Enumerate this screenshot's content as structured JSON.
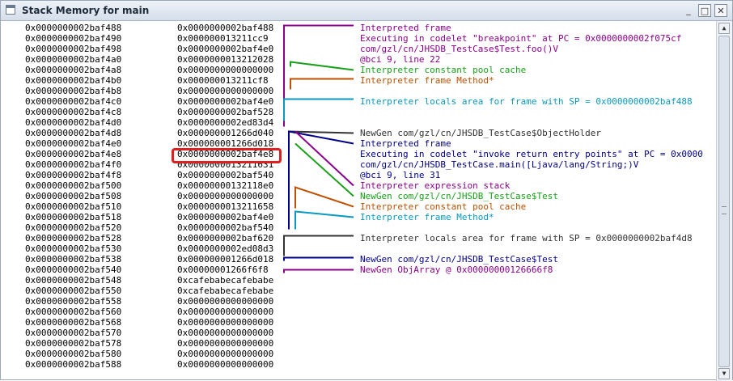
{
  "window": {
    "title": "Stack Memory for main",
    "icon": "window-icon"
  },
  "titlebar_buttons": {
    "iconify": "_",
    "maximize": "□",
    "close": "✕"
  },
  "rows": [
    {
      "addr": "0x0000000002baf488",
      "val": "0x0000000002baf488"
    },
    {
      "addr": "0x0000000002baf490",
      "val": "0x000000013211cc9"
    },
    {
      "addr": "0x0000000002baf498",
      "val": "0x0000000002baf4e0"
    },
    {
      "addr": "0x0000000002baf4a0",
      "val": "0x0000000013212028"
    },
    {
      "addr": "0x0000000002baf4a8",
      "val": "0x0000000000000000"
    },
    {
      "addr": "0x0000000002baf4b0",
      "val": "0x000000013211cf8"
    },
    {
      "addr": "0x0000000002baf4b8",
      "val": "0x0000000000000000"
    },
    {
      "addr": "0x0000000002baf4c0",
      "val": "0x0000000002baf4e0"
    },
    {
      "addr": "0x0000000002baf4c8",
      "val": "0x0000000002baf528"
    },
    {
      "addr": "0x0000000002baf4d0",
      "val": "0x0000000002ed83d4"
    },
    {
      "addr": "0x0000000002baf4d8",
      "val": "0x000000001266d040"
    },
    {
      "addr": "0x0000000002baf4e0",
      "val": "0x000000001266d018"
    },
    {
      "addr": "0x0000000002baf4e8",
      "val": "0x0000000002baf4e8"
    },
    {
      "addr": "0x0000000002baf4f0",
      "val": "0x0000000013211631"
    },
    {
      "addr": "0x0000000002baf4f8",
      "val": "0x0000000002baf540"
    },
    {
      "addr": "0x0000000002baf500",
      "val": "0x00000000132118e0"
    },
    {
      "addr": "0x0000000002baf508",
      "val": "0x0000000000000000"
    },
    {
      "addr": "0x0000000002baf510",
      "val": "0x0000000013211658"
    },
    {
      "addr": "0x0000000002baf518",
      "val": "0x0000000002baf4e0"
    },
    {
      "addr": "0x0000000002baf520",
      "val": "0x0000000002baf540"
    },
    {
      "addr": "0x0000000002baf528",
      "val": "0x0000000002baf620"
    },
    {
      "addr": "0x0000000002baf530",
      "val": "0x0000000002ed08d3"
    },
    {
      "addr": "0x0000000002baf538",
      "val": "0x000000001266d018"
    },
    {
      "addr": "0x0000000002baf540",
      "val": "0x00000001266f6f8"
    },
    {
      "addr": "0x0000000002baf548",
      "val": "0xcafebabecafebabe"
    },
    {
      "addr": "0x0000000002baf550",
      "val": "0xcafebabecafebabe"
    },
    {
      "addr": "0x0000000002baf558",
      "val": "0x0000000000000000"
    },
    {
      "addr": "0x0000000002baf560",
      "val": "0x0000000000000000"
    },
    {
      "addr": "0x0000000002baf568",
      "val": "0x0000000000000000"
    },
    {
      "addr": "0x0000000002baf570",
      "val": "0x0000000000000000"
    },
    {
      "addr": "0x0000000002baf578",
      "val": "0x0000000000000000"
    },
    {
      "addr": "0x0000000002baf580",
      "val": "0x0000000000000000"
    },
    {
      "addr": "0x0000000002baf588",
      "val": "0x0000000000000000"
    }
  ],
  "annotations": [
    {
      "text": "Interpreted frame",
      "color": "#8b008b"
    },
    {
      "text": "Executing in codelet \"breakpoint\" at PC = 0x0000000002f075cf",
      "color": "#8b008b"
    },
    {
      "text": "com/gzl/cn/JHSDB_TestCase$Test.foo()V",
      "color": "#8b008b"
    },
    {
      "text": "@bci 9, line 22",
      "color": "#8b008b"
    },
    {
      "text": "Interpreter constant pool cache",
      "color": "#1aa01a"
    },
    {
      "text": "Interpreter frame Method*",
      "color": "#c05000"
    },
    {
      "text": "Interpreter locals area for frame with SP = 0x0000000002baf488",
      "color": "#0899c0"
    },
    {
      "text": "NewGen com/gzl/cn/JHSDB_TestCase$ObjectHolder",
      "color": "#333333"
    },
    {
      "text": "Interpreted frame",
      "color": "#00008b"
    },
    {
      "text": "Executing in codelet \"invoke return entry points\" at PC = 0x0000",
      "color": "#00008b"
    },
    {
      "text": "com/gzl/cn/JHSDB_TestCase.main([Ljava/lang/String;)V",
      "color": "#00008b"
    },
    {
      "text": "@bci 9, line 31",
      "color": "#00008b"
    },
    {
      "text": "Interpreter expression stack",
      "color": "#8b008b"
    },
    {
      "text": "NewGen com/gzl/cn/JHSDB_TestCase$Test",
      "color": "#1aa01a"
    },
    {
      "text": "Interpreter constant pool cache",
      "color": "#c05000"
    },
    {
      "text": "Interpreter frame Method*",
      "color": "#0899c0"
    },
    {
      "text": "Interpreter locals area for frame with SP = 0x0000000002baf4d8",
      "color": "#333333"
    },
    {
      "text": "NewGen com/gzl/cn/JHSDB_TestCase$Test",
      "color": "#00008b"
    },
    {
      "text": "NewGen ObjArray @ 0x00000000126666f8",
      "color": "#8b008b"
    }
  ],
  "annotation_rows": [
    0,
    1,
    2,
    3,
    4,
    5,
    7,
    10,
    11,
    12,
    13,
    14,
    15,
    16,
    17,
    18,
    20,
    22,
    23
  ],
  "highlight_color": "#e02020"
}
